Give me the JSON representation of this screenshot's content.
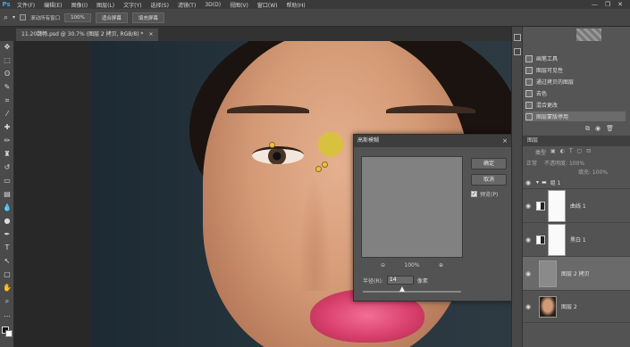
{
  "menubar": {
    "logo": "Ps",
    "items": [
      "文件(F)",
      "编辑(E)",
      "图像(I)",
      "图层(L)",
      "文字(Y)",
      "选择(S)",
      "滤镜(T)",
      "3D(D)",
      "视图(V)",
      "窗口(W)",
      "帮助(H)"
    ],
    "controls": [
      "—",
      "❐",
      "✕"
    ]
  },
  "options": {
    "scroll_all_label": "滚动所有窗口",
    "zoom_value": "100%",
    "fit_screen_button": "适合屏幕",
    "fill_screen_button": "填充屏幕"
  },
  "document_tab": {
    "title": "11.20魏畅.psd @ 30.7% (图层 2 拷贝, RGB/8) *",
    "close": "×"
  },
  "dialog": {
    "title": "高斯模糊",
    "close": "×",
    "ok_label": "确定",
    "cancel_label": "取消",
    "preview_label": "预览(P)",
    "preview_checked": true,
    "zoom_out": "⊖",
    "zoom_level": "100%",
    "zoom_in": "⊕",
    "radius_label": "半径(R):",
    "radius_value": "14",
    "radius_unit": "像素"
  },
  "history_panel": {
    "items": [
      "画笔工具",
      "图层可见性",
      "通过拷贝的图层",
      "去色",
      "混合更改",
      "图层蒙版停用"
    ],
    "active_index": 5
  },
  "layers_panel": {
    "tab_label": "图层",
    "filter_label": "类型",
    "blend_mode": "正常",
    "opacity_label": "不透明度: 100%",
    "fill_label": "填充: 100%",
    "group_name": "组 1",
    "layers": [
      {
        "name": "曲线 1"
      },
      {
        "name": "黑白 1"
      },
      {
        "name": "图层 2 拷贝",
        "selected": true
      },
      {
        "name": "图层 2"
      }
    ]
  }
}
